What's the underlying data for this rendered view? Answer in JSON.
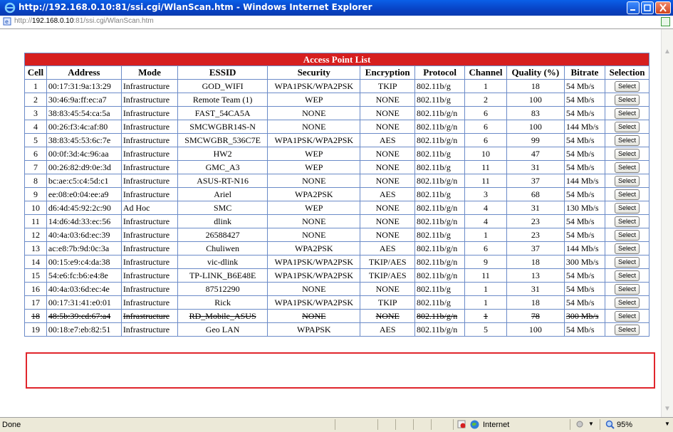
{
  "window": {
    "title": "http://192.168.0.10:81/ssi.cgi/WlanScan.htm - Windows Internet Explorer"
  },
  "address": {
    "prefix": "http://",
    "host": "192.168.0.10",
    "rest": ":81/ssi.cgi/WlanScan.htm"
  },
  "table": {
    "caption": "Access Point List",
    "headers": [
      "Cell",
      "Address",
      "Mode",
      "ESSID",
      "Security",
      "Encryption",
      "Protocol",
      "Channel",
      "Quality (%)",
      "Bitrate",
      "Selection"
    ],
    "select_label": "Select",
    "rows": [
      [
        "1",
        "00:17:31:9a:13:29",
        "Infrastructure",
        "GOD_WIFI",
        "WPA1PSK/WPA2PSK",
        "TKIP",
        "802.11b/g",
        "1",
        "18",
        "54 Mb/s"
      ],
      [
        "2",
        "30:46:9a:ff:ec:a7",
        "Infrastructure",
        "Remote Team (1)",
        "WEP",
        "NONE",
        "802.11b/g",
        "2",
        "100",
        "54 Mb/s"
      ],
      [
        "3",
        "38:83:45:54:ca:5a",
        "Infrastructure",
        "FAST_54CA5A",
        "NONE",
        "NONE",
        "802.11b/g/n",
        "6",
        "83",
        "54 Mb/s"
      ],
      [
        "4",
        "00:26:f3:4c:af:80",
        "Infrastructure",
        "SMCWGBR14S-N",
        "NONE",
        "NONE",
        "802.11b/g/n",
        "6",
        "100",
        "144 Mb/s"
      ],
      [
        "5",
        "38:83:45:53:6c:7e",
        "Infrastructure",
        "SMCWGBR_536C7E",
        "WPA1PSK/WPA2PSK",
        "AES",
        "802.11b/g/n",
        "6",
        "99",
        "54 Mb/s"
      ],
      [
        "6",
        "00:0f:3d:4c:96:aa",
        "Infrastructure",
        "HW2",
        "WEP",
        "NONE",
        "802.11b/g",
        "10",
        "47",
        "54 Mb/s"
      ],
      [
        "7",
        "00:26:82:d9:0e:3d",
        "Infrastructure",
        "GMC_A3",
        "WEP",
        "NONE",
        "802.11b/g",
        "11",
        "31",
        "54 Mb/s"
      ],
      [
        "8",
        "bc:ae:c5:c4:5d:c1",
        "Infrastructure",
        "ASUS-RT-N16",
        "NONE",
        "NONE",
        "802.11b/g/n",
        "11",
        "37",
        "144 Mb/s"
      ],
      [
        "9",
        "ee:08:e0:04:ee:a9",
        "Infrastructure",
        "Ariel",
        "WPA2PSK",
        "AES",
        "802.11b/g",
        "3",
        "68",
        "54 Mb/s"
      ],
      [
        "10",
        "d6:4d:45:92:2c:90",
        "Ad Hoc",
        "SMC",
        "WEP",
        "NONE",
        "802.11b/g/n",
        "4",
        "31",
        "130 Mb/s"
      ],
      [
        "11",
        "14:d6:4d:33:ec:56",
        "Infrastructure",
        "dlink",
        "NONE",
        "NONE",
        "802.11b/g/n",
        "4",
        "23",
        "54 Mb/s"
      ],
      [
        "12",
        "40:4a:03:6d:ec:39",
        "Infrastructure",
        "26588427",
        "NONE",
        "NONE",
        "802.11b/g",
        "1",
        "23",
        "54 Mb/s"
      ],
      [
        "13",
        "ac:e8:7b:9d:0c:3a",
        "Infrastructure",
        "Chuliwen",
        "WPA2PSK",
        "AES",
        "802.11b/g/n",
        "6",
        "37",
        "144 Mb/s"
      ],
      [
        "14",
        "00:15:e9:c4:da:38",
        "Infrastructure",
        "vic-dlink",
        "WPA1PSK/WPA2PSK",
        "TKIP/AES",
        "802.11b/g/n",
        "9",
        "18",
        "300 Mb/s"
      ],
      [
        "15",
        "54:e6:fc:b6:e4:8e",
        "Infrastructure",
        "TP-LINK_B6E48E",
        "WPA1PSK/WPA2PSK",
        "TKIP/AES",
        "802.11b/g/n",
        "11",
        "13",
        "54 Mb/s"
      ],
      [
        "16",
        "40:4a:03:6d:ec:4e",
        "Infrastructure",
        "87512290",
        "NONE",
        "NONE",
        "802.11b/g",
        "1",
        "31",
        "54 Mb/s"
      ],
      [
        "17",
        "00:17:31:41:e0:01",
        "Infrastructure",
        "Rick",
        "WPA1PSK/WPA2PSK",
        "TKIP",
        "802.11b/g",
        "1",
        "18",
        "54 Mb/s"
      ],
      [
        "18",
        "48:5b:39:cd:67:a4",
        "Infrastructure",
        "RD_Mobile_ASUS",
        "NONE",
        "NONE",
        "802.11b/g/n",
        "1",
        "78",
        "300 Mb/s"
      ],
      [
        "19",
        "00:18:e7:eb:82:51",
        "Infrastructure",
        "Geo LAN",
        "WPAPSK",
        "AES",
        "802.11b/g/n",
        "5",
        "100",
        "54 Mb/s"
      ]
    ]
  },
  "statusbar": {
    "status": "Done",
    "zone": "Internet",
    "zoom": "95%"
  },
  "colors": {
    "caption_bg": "#d61f1f",
    "border": "#6b8bc8",
    "highlight": "#e0262c"
  }
}
